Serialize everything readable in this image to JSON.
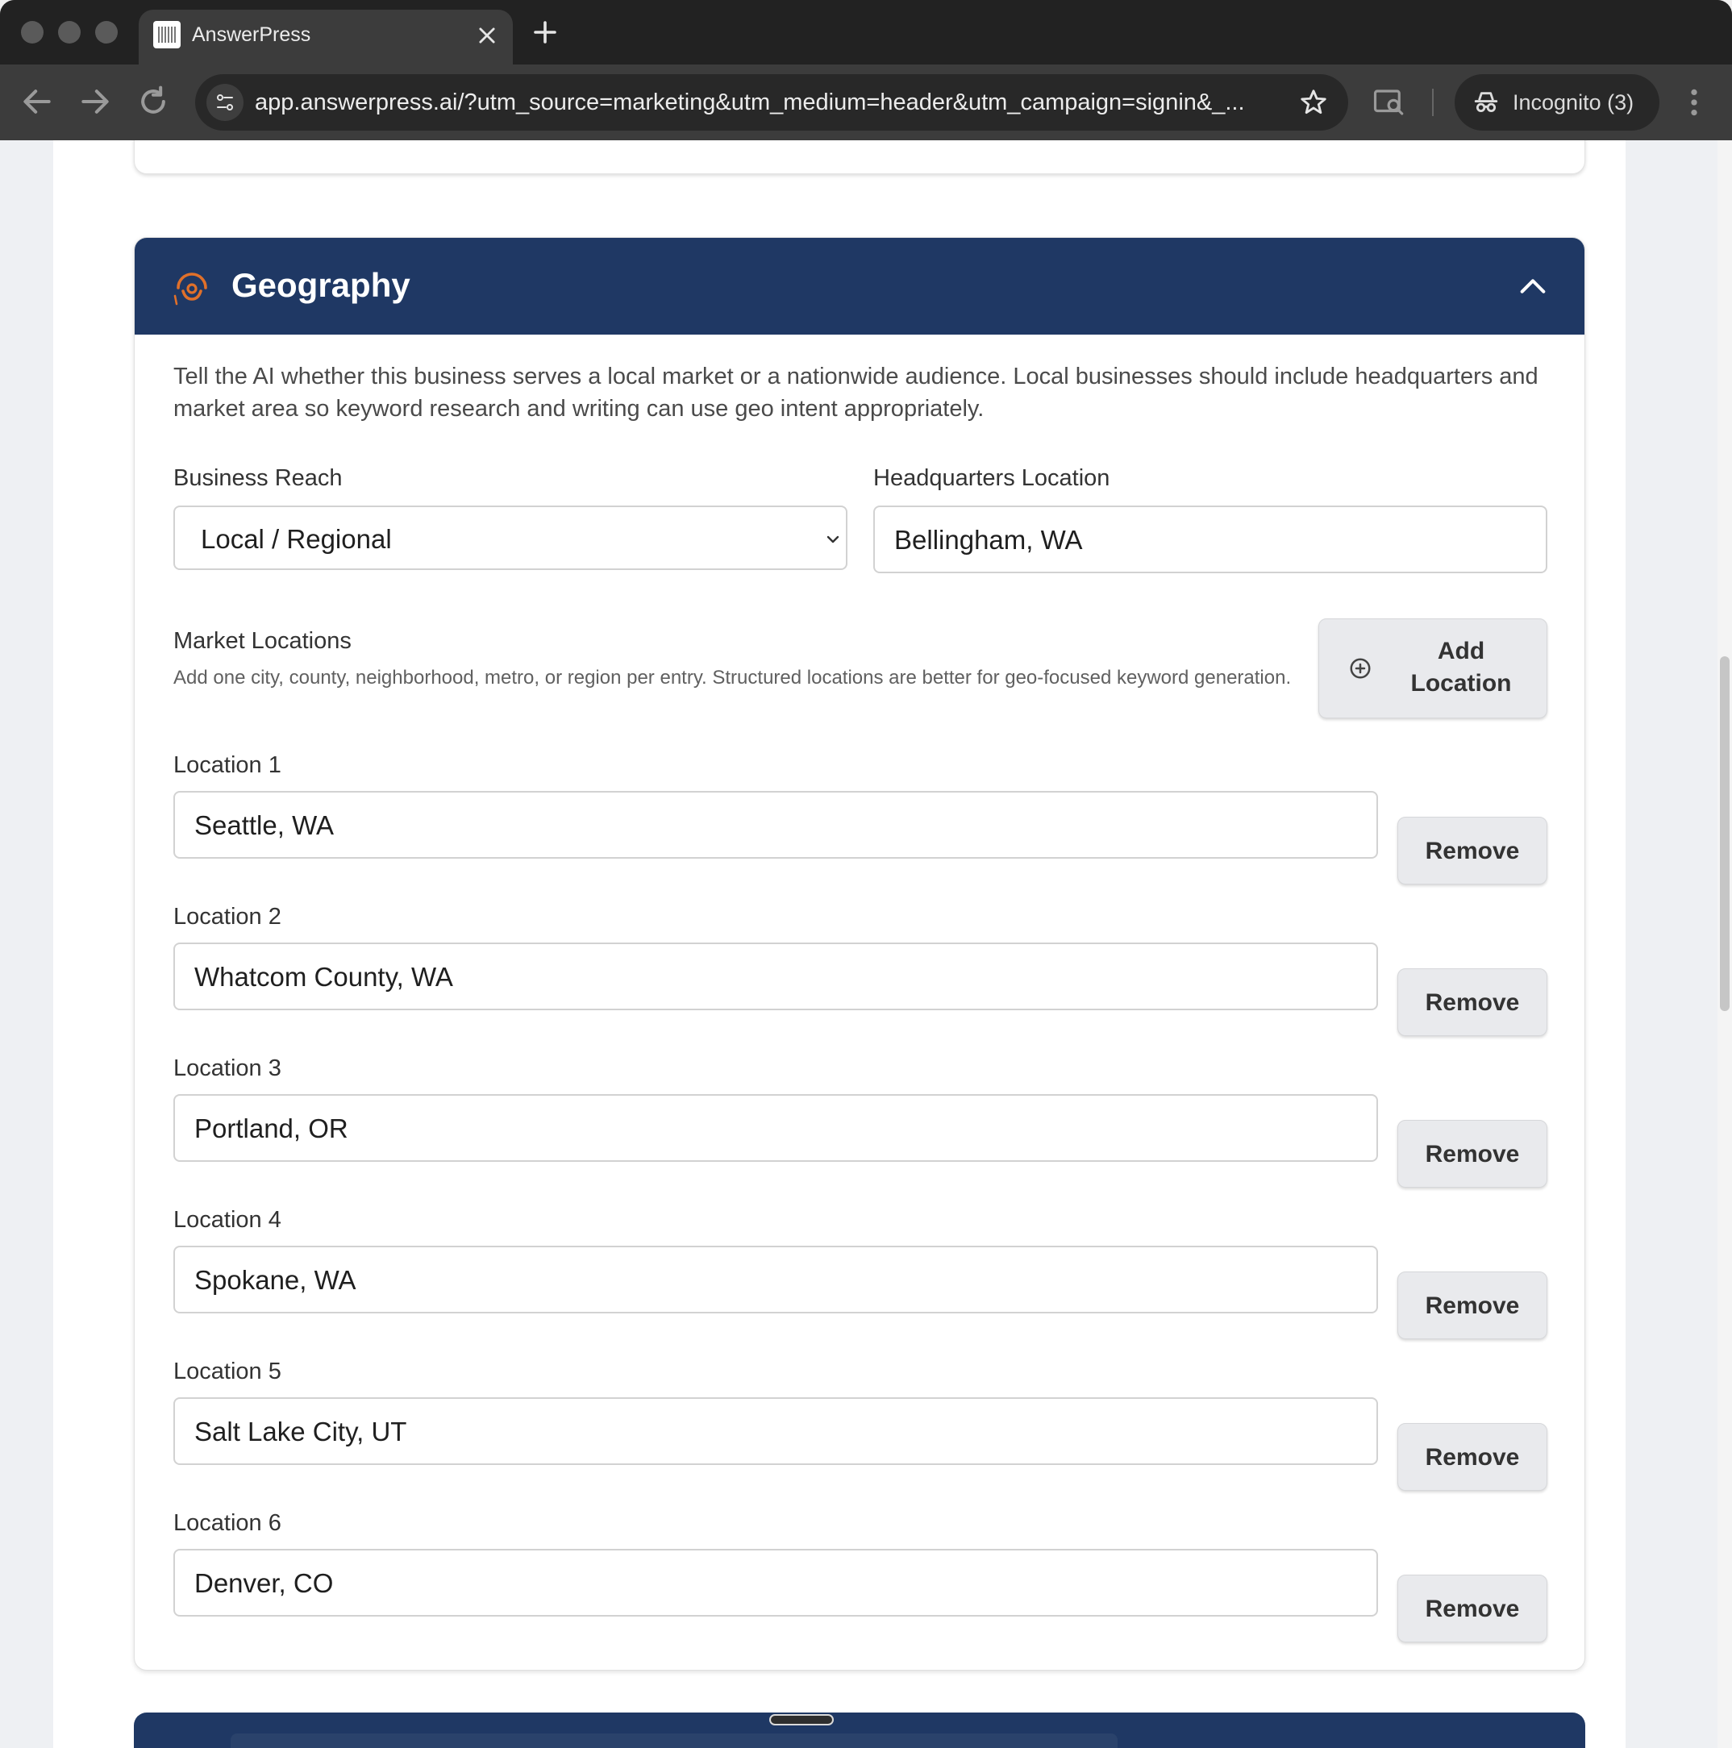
{
  "browser": {
    "tab_title": "AnswerPress",
    "url": "app.answerpress.ai/?utm_source=marketing&utm_medium=header&utm_campaign=signin&_...",
    "incognito_label": "Incognito (3)"
  },
  "section": {
    "title": "Geography",
    "description": "Tell the AI whether this business serves a local market or a nationwide audience. Local businesses should include headquarters and market area so keyword research and writing can use geo intent appropriately.",
    "business_reach": {
      "label": "Business Reach",
      "value": "Local / Regional"
    },
    "headquarters": {
      "label": "Headquarters Location",
      "value": "Bellingham, WA"
    },
    "market_locations": {
      "label": "Market Locations",
      "help": "Add one city, county, neighborhood, metro, or region per entry. Structured locations are better for geo-focused keyword generation.",
      "add_button": "Add Location",
      "remove_label": "Remove",
      "items": [
        {
          "label": "Location 1",
          "value": "Seattle, WA"
        },
        {
          "label": "Location 2",
          "value": "Whatcom County, WA"
        },
        {
          "label": "Location 3",
          "value": "Portland, OR"
        },
        {
          "label": "Location 4",
          "value": "Spokane, WA"
        },
        {
          "label": "Location 5",
          "value": "Salt Lake City, UT"
        },
        {
          "label": "Location 6",
          "value": "Denver, CO"
        }
      ]
    }
  },
  "colors": {
    "header_bg": "#1f3864",
    "accent_orange": "#e0702a"
  }
}
